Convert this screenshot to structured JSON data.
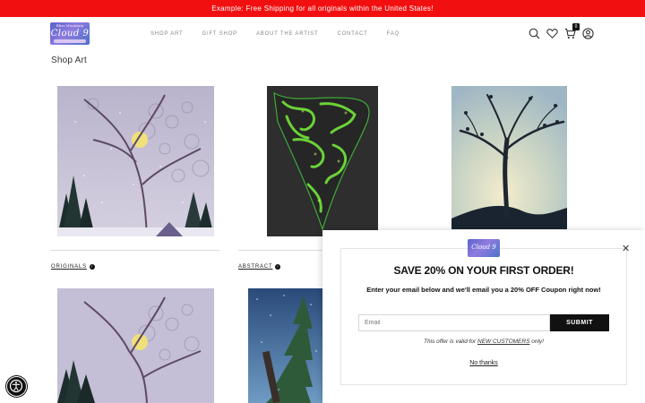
{
  "announcement": "Example: Free Shipping for all originals within the United States!",
  "logo": {
    "line1": "Bliss Mountain",
    "line2": "Cloud 9"
  },
  "nav": [
    "SHOP ART",
    "GIFT SHOP",
    "ABOUT THE ARTIST",
    "CONTACT",
    "FAQ"
  ],
  "header_icons": [
    "search-icon",
    "heart-icon",
    "cart-icon",
    "account-icon"
  ],
  "cart_count": "0",
  "page_title": "Shop Art",
  "categories": [
    {
      "label": "ORIGINALS"
    },
    {
      "label": "ABSTRACT"
    }
  ],
  "popup": {
    "logo_text": "Cloud 9",
    "headline": "SAVE 20% ON YOUR FIRST ORDER!",
    "subtext": "Enter your email below and we'll email you a 20% OFF Coupon right now!",
    "email_placeholder": "Email",
    "submit_label": "SUBMIT",
    "note_prefix": "This offer is valid for ",
    "note_link": "NEW CUSTOMERS",
    "note_suffix": " only!",
    "no_thanks": "No thanks",
    "close_glyph": "✕"
  },
  "colors": {
    "announcement_bg": "#f20f0f",
    "submit_bg": "#111111"
  }
}
